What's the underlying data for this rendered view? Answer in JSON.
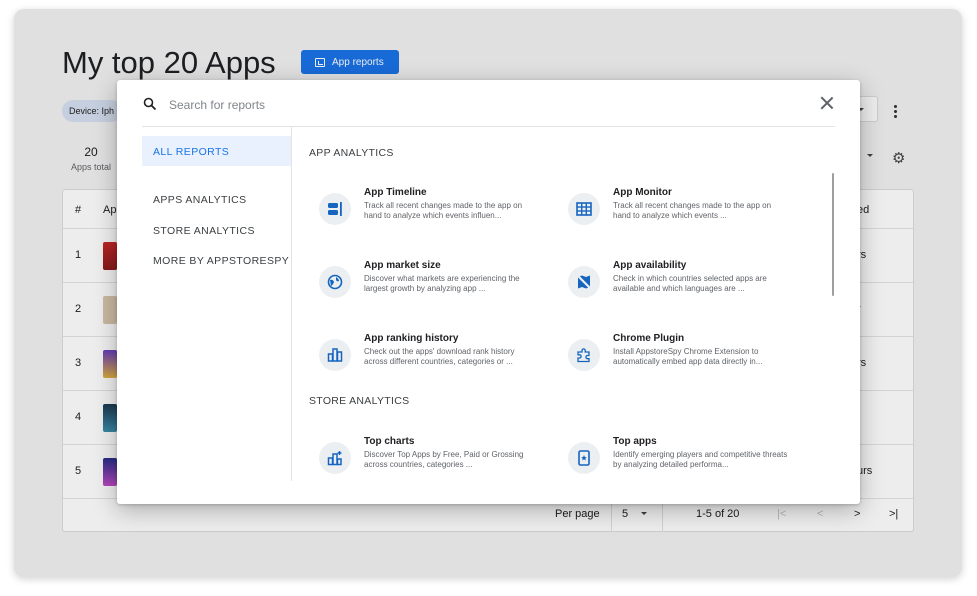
{
  "page": {
    "title": "My top 20 Apps",
    "reports_button": "App reports",
    "device_chip": "Device: Iph",
    "total_count": "20",
    "total_label": "Apps total"
  },
  "table": {
    "header_num": "#",
    "header_app": "Ap",
    "header_right": "ed",
    "rows": [
      {
        "num": "1",
        "right": "rs"
      },
      {
        "num": "2",
        "right": "r"
      },
      {
        "num": "3",
        "right": "rs"
      },
      {
        "num": "4",
        "right": ""
      },
      {
        "num": "5",
        "right": "urs"
      }
    ]
  },
  "pagination": {
    "per_page_label": "Per page",
    "per_page_value": "5",
    "range": "1-5 of 20",
    "first": "|<",
    "prev": "<",
    "next": ">",
    "last": ">|"
  },
  "modal": {
    "search_placeholder": "Search for reports",
    "sidebar": {
      "active": "ALL REPORTS",
      "items": [
        "APPS ANALYTICS",
        "STORE ANALYTICS",
        "MORE BY APPSTORESPY"
      ]
    },
    "sections": [
      {
        "title": "APP ANALYTICS",
        "items": [
          {
            "name": "App Timeline",
            "desc": "Track all recent changes made to the app on hand to analyze which events influen...",
            "icon": "timeline-icon"
          },
          {
            "name": "App Monitor",
            "desc": "Track all recent changes made to the app on hand to analyze which events ...",
            "icon": "table-grid-icon"
          },
          {
            "name": "App market size",
            "desc": "Discover what markets are experiencing the largest growth by analyzing app ...",
            "icon": "globe-icon"
          },
          {
            "name": "App availability",
            "desc": "Check in which countries selected apps are available and which languages are ...",
            "icon": "map-off-icon"
          },
          {
            "name": "App ranking history",
            "desc": "Check out the apps' download rank history across different countries, categories or ...",
            "icon": "bar-chart-icon"
          },
          {
            "name": "Chrome Plugin",
            "desc": "Install AppstoreSpy Chrome Extension to automatically embed app data directly in...",
            "icon": "puzzle-icon"
          }
        ]
      },
      {
        "title": "STORE ANALYTICS",
        "items": [
          {
            "name": "Top charts",
            "desc": "Discover Top Apps by Free, Paid or Grossing across countries, categories ...",
            "icon": "bar-chart-plus-icon"
          },
          {
            "name": "Top apps",
            "desc": "Identify emerging players and competitive threats by analyzing detailed performa...",
            "icon": "phone-star-icon"
          }
        ]
      }
    ]
  },
  "colors": {
    "accent": "#1a73e8",
    "active_bg": "#e8f1fd",
    "icon_bg": "#eceff1"
  }
}
